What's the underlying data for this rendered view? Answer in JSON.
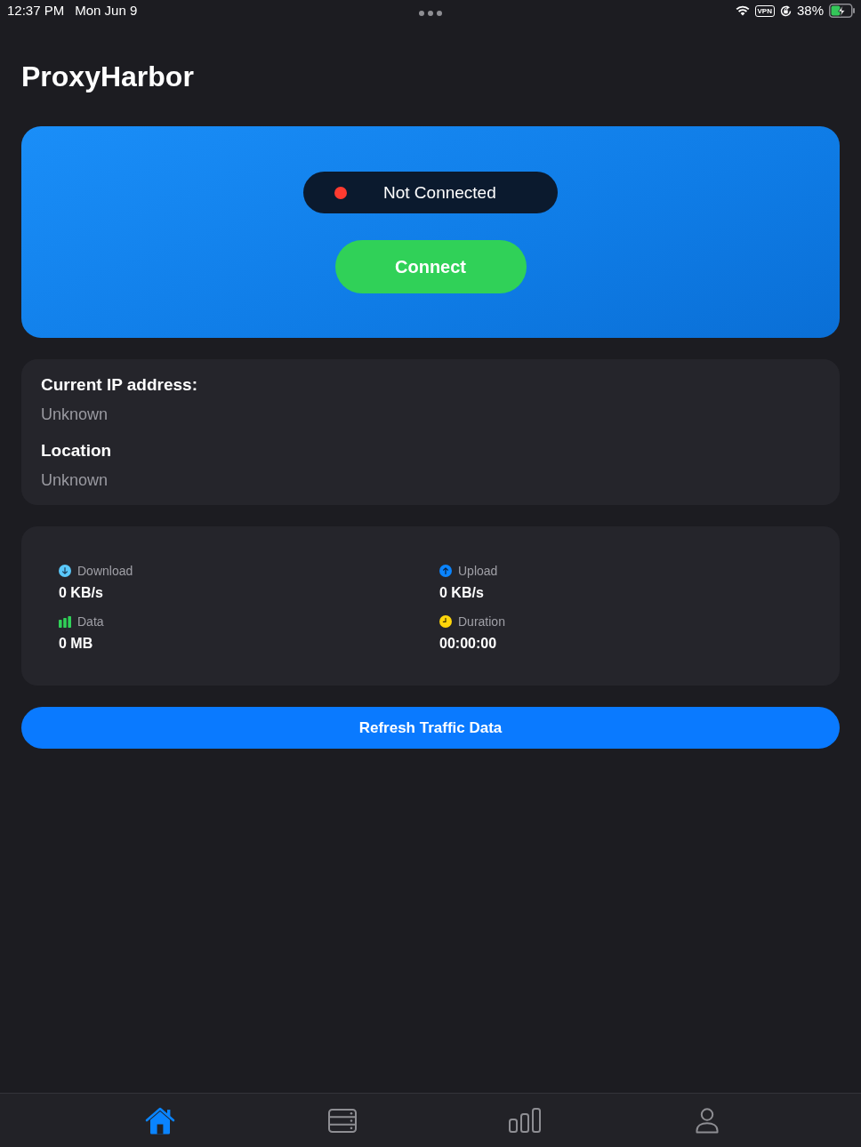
{
  "status_bar": {
    "time": "12:37 PM",
    "date": "Mon Jun 9",
    "vpn_badge": "VPN",
    "battery_percent": "38%",
    "charging": true
  },
  "app_title": "ProxyHarbor",
  "hero": {
    "status": {
      "label": "Not Connected",
      "connected": false
    },
    "button": {
      "label": "Connect"
    }
  },
  "info": [
    {
      "label": "Current IP address:",
      "value": "Unknown"
    },
    {
      "label": "Location",
      "value": "Unknown"
    }
  ],
  "stats": [
    {
      "kind": "download",
      "label": "Download",
      "value": "0 KB/s"
    },
    {
      "kind": "upload",
      "label": "Upload",
      "value": "0 KB/s"
    },
    {
      "kind": "data",
      "label": "Data",
      "value": "0 MB"
    },
    {
      "kind": "duration",
      "label": "Duration",
      "value": "00:00:00"
    }
  ],
  "refresh_button": {
    "label": "Refresh Traffic Data"
  },
  "tab_bar": [
    {
      "kind": "home",
      "selected": true
    },
    {
      "kind": "servers",
      "selected": false
    },
    {
      "kind": "stats",
      "selected": false
    },
    {
      "kind": "profile",
      "selected": false
    }
  ]
}
